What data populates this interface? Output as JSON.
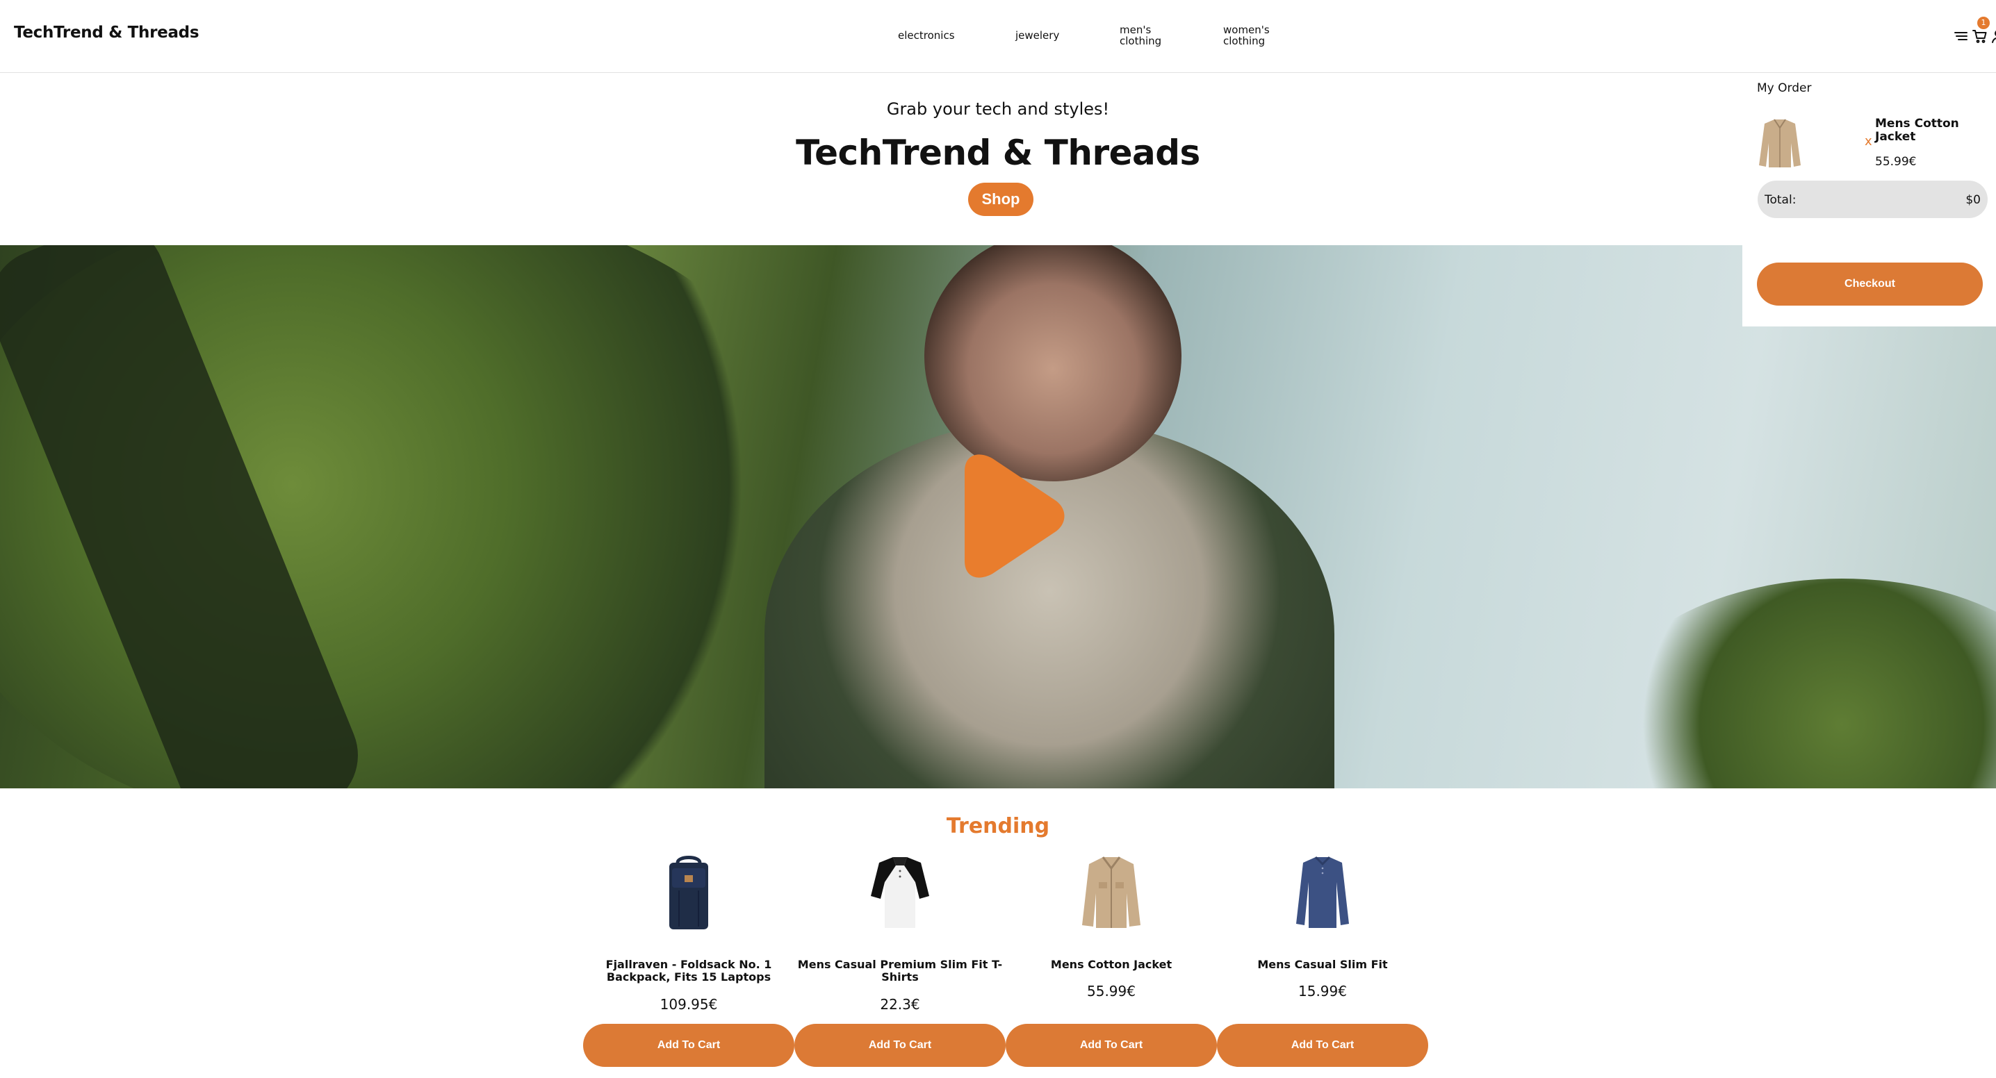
{
  "header": {
    "brand": "TechTrend & Threads",
    "nav": [
      "electronics",
      "jewelery",
      "men's clothing",
      "women's clothing"
    ],
    "cart_count": "1",
    "icons": [
      "menu-icon",
      "cart-icon",
      "user-icon"
    ]
  },
  "hero": {
    "subtitle": "Grab your tech and styles!",
    "title": "TechTrend & Threads",
    "shop_label": "Shop"
  },
  "video": {
    "play_icon": "play-icon"
  },
  "trending": {
    "heading": "Trending",
    "products": [
      {
        "name": "Fjallraven - Foldsack No. 1 Backpack, Fits 15 Laptops",
        "price": "109.95€",
        "button": "Add To Cart"
      },
      {
        "name": "Mens Casual Premium Slim Fit T-Shirts",
        "price": "22.3€",
        "button": "Add To Cart"
      },
      {
        "name": "Mens Cotton Jacket",
        "price": "55.99€",
        "button": "Add To Cart"
      },
      {
        "name": "Mens Casual Slim Fit",
        "price": "15.99€",
        "button": "Add To Cart"
      }
    ]
  },
  "cart": {
    "heading": "My Order",
    "items": [
      {
        "name": "Mens Cotton Jacket",
        "price": "55.99€",
        "remove": "x"
      }
    ],
    "total_label": "Total:",
    "total_value": "$0",
    "checkout_label": "Checkout"
  },
  "colors": {
    "accent": "#e47a2e",
    "button": "#dc7a35",
    "total_bg": "#e3e3e3"
  }
}
